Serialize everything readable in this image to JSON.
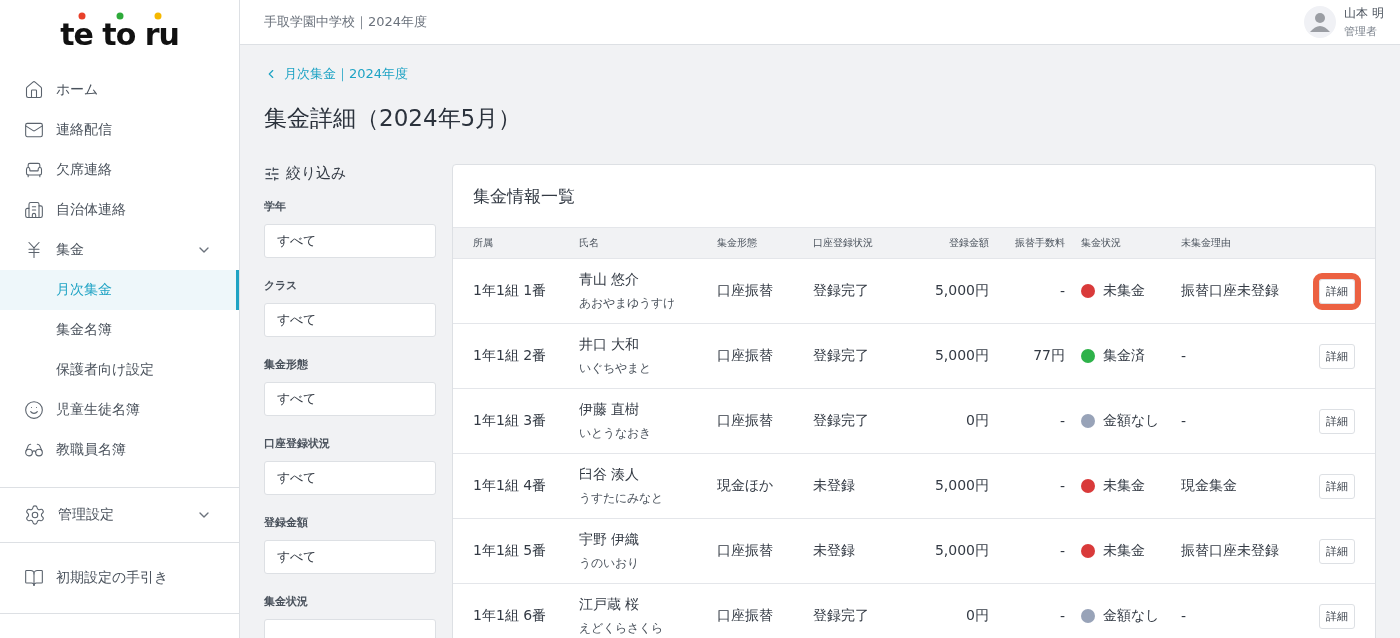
{
  "sidebar": {
    "logo": "te to ru",
    "items": [
      {
        "label": "ホーム",
        "selected": false
      },
      {
        "label": "連絡配信",
        "selected": false
      },
      {
        "label": "欠席連絡",
        "selected": false
      },
      {
        "label": "自治体連絡",
        "selected": false
      },
      {
        "label": "集金",
        "selected": false,
        "expanded": true,
        "children": [
          {
            "label": "月次集金",
            "selected": true
          },
          {
            "label": "集金名簿",
            "selected": false
          },
          {
            "label": "保護者向け設定",
            "selected": false
          }
        ]
      },
      {
        "label": "児童生徒名簿",
        "selected": false
      },
      {
        "label": "教職員名簿",
        "selected": false
      }
    ],
    "settings": {
      "label": "管理設定",
      "expanded": false
    },
    "guide": {
      "label": "初期設定の手引き"
    }
  },
  "header": {
    "school": "手取学園中学校｜2024年度",
    "user_name": "山本 明",
    "user_role": "管理者"
  },
  "breadcrumb": "月次集金｜2024年度",
  "title": "集金詳細（2024年5月）",
  "filter": {
    "title": "絞り込み",
    "fields": [
      {
        "label": "学年",
        "value": "すべて"
      },
      {
        "label": "クラス",
        "value": "すべて"
      },
      {
        "label": "集金形態",
        "value": "すべて"
      },
      {
        "label": "口座登録状況",
        "value": "すべて"
      },
      {
        "label": "登録金額",
        "value": "すべて"
      },
      {
        "label": "集金状況"
      }
    ]
  },
  "table": {
    "title": "集金情報一覧",
    "columns": [
      "所属",
      "氏名",
      "集金形態",
      "口座登録状況",
      "登録金額",
      "振替手数料",
      "集金状況",
      "未集金理由"
    ],
    "rows": [
      {
        "group": "1年1組 1番",
        "name": "青山 悠介",
        "kana": "あおやまゆうすけ",
        "method": "口座振替",
        "registration": "登録完了",
        "amount": "5,000円",
        "fee": "-",
        "status": "未集金",
        "color": "#d93a3a",
        "reason": "振替口座未登録",
        "button": "詳細",
        "highlighted": true
      },
      {
        "group": "1年1組 2番",
        "name": "井口 大和",
        "kana": "いぐちやまと",
        "method": "口座振替",
        "registration": "登録完了",
        "amount": "5,000円",
        "fee": "77円",
        "status": "集金済",
        "color": "#2eb24a",
        "reason": "-",
        "button": "詳細",
        "highlighted": false
      },
      {
        "group": "1年1組 3番",
        "name": "伊藤 直樹",
        "kana": "いとうなおき",
        "method": "口座振替",
        "registration": "登録完了",
        "amount": "0円",
        "fee": "-",
        "status": "金額なし",
        "color": "#98a3b8",
        "reason": "-",
        "button": "詳細",
        "highlighted": false
      },
      {
        "group": "1年1組 4番",
        "name": "臼谷 湊人",
        "kana": "うすたにみなと",
        "method": "現金ほか",
        "registration": "未登録",
        "amount": "5,000円",
        "fee": "-",
        "status": "未集金",
        "color": "#d93a3a",
        "reason": "現金集金",
        "button": "詳細",
        "highlighted": false
      },
      {
        "group": "1年1組 5番",
        "name": "宇野 伊織",
        "kana": "うのいおり",
        "method": "口座振替",
        "registration": "未登録",
        "amount": "5,000円",
        "fee": "-",
        "status": "未集金",
        "color": "#d93a3a",
        "reason": "振替口座未登録",
        "button": "詳細",
        "highlighted": false
      },
      {
        "group": "1年1組 6番",
        "name": "江戸蔵 桜",
        "kana": "えどくらさくら",
        "method": "口座振替",
        "registration": "登録完了",
        "amount": "0円",
        "fee": "-",
        "status": "金額なし",
        "color": "#98a3b8",
        "reason": "-",
        "button": "詳細",
        "highlighted": false
      }
    ]
  }
}
